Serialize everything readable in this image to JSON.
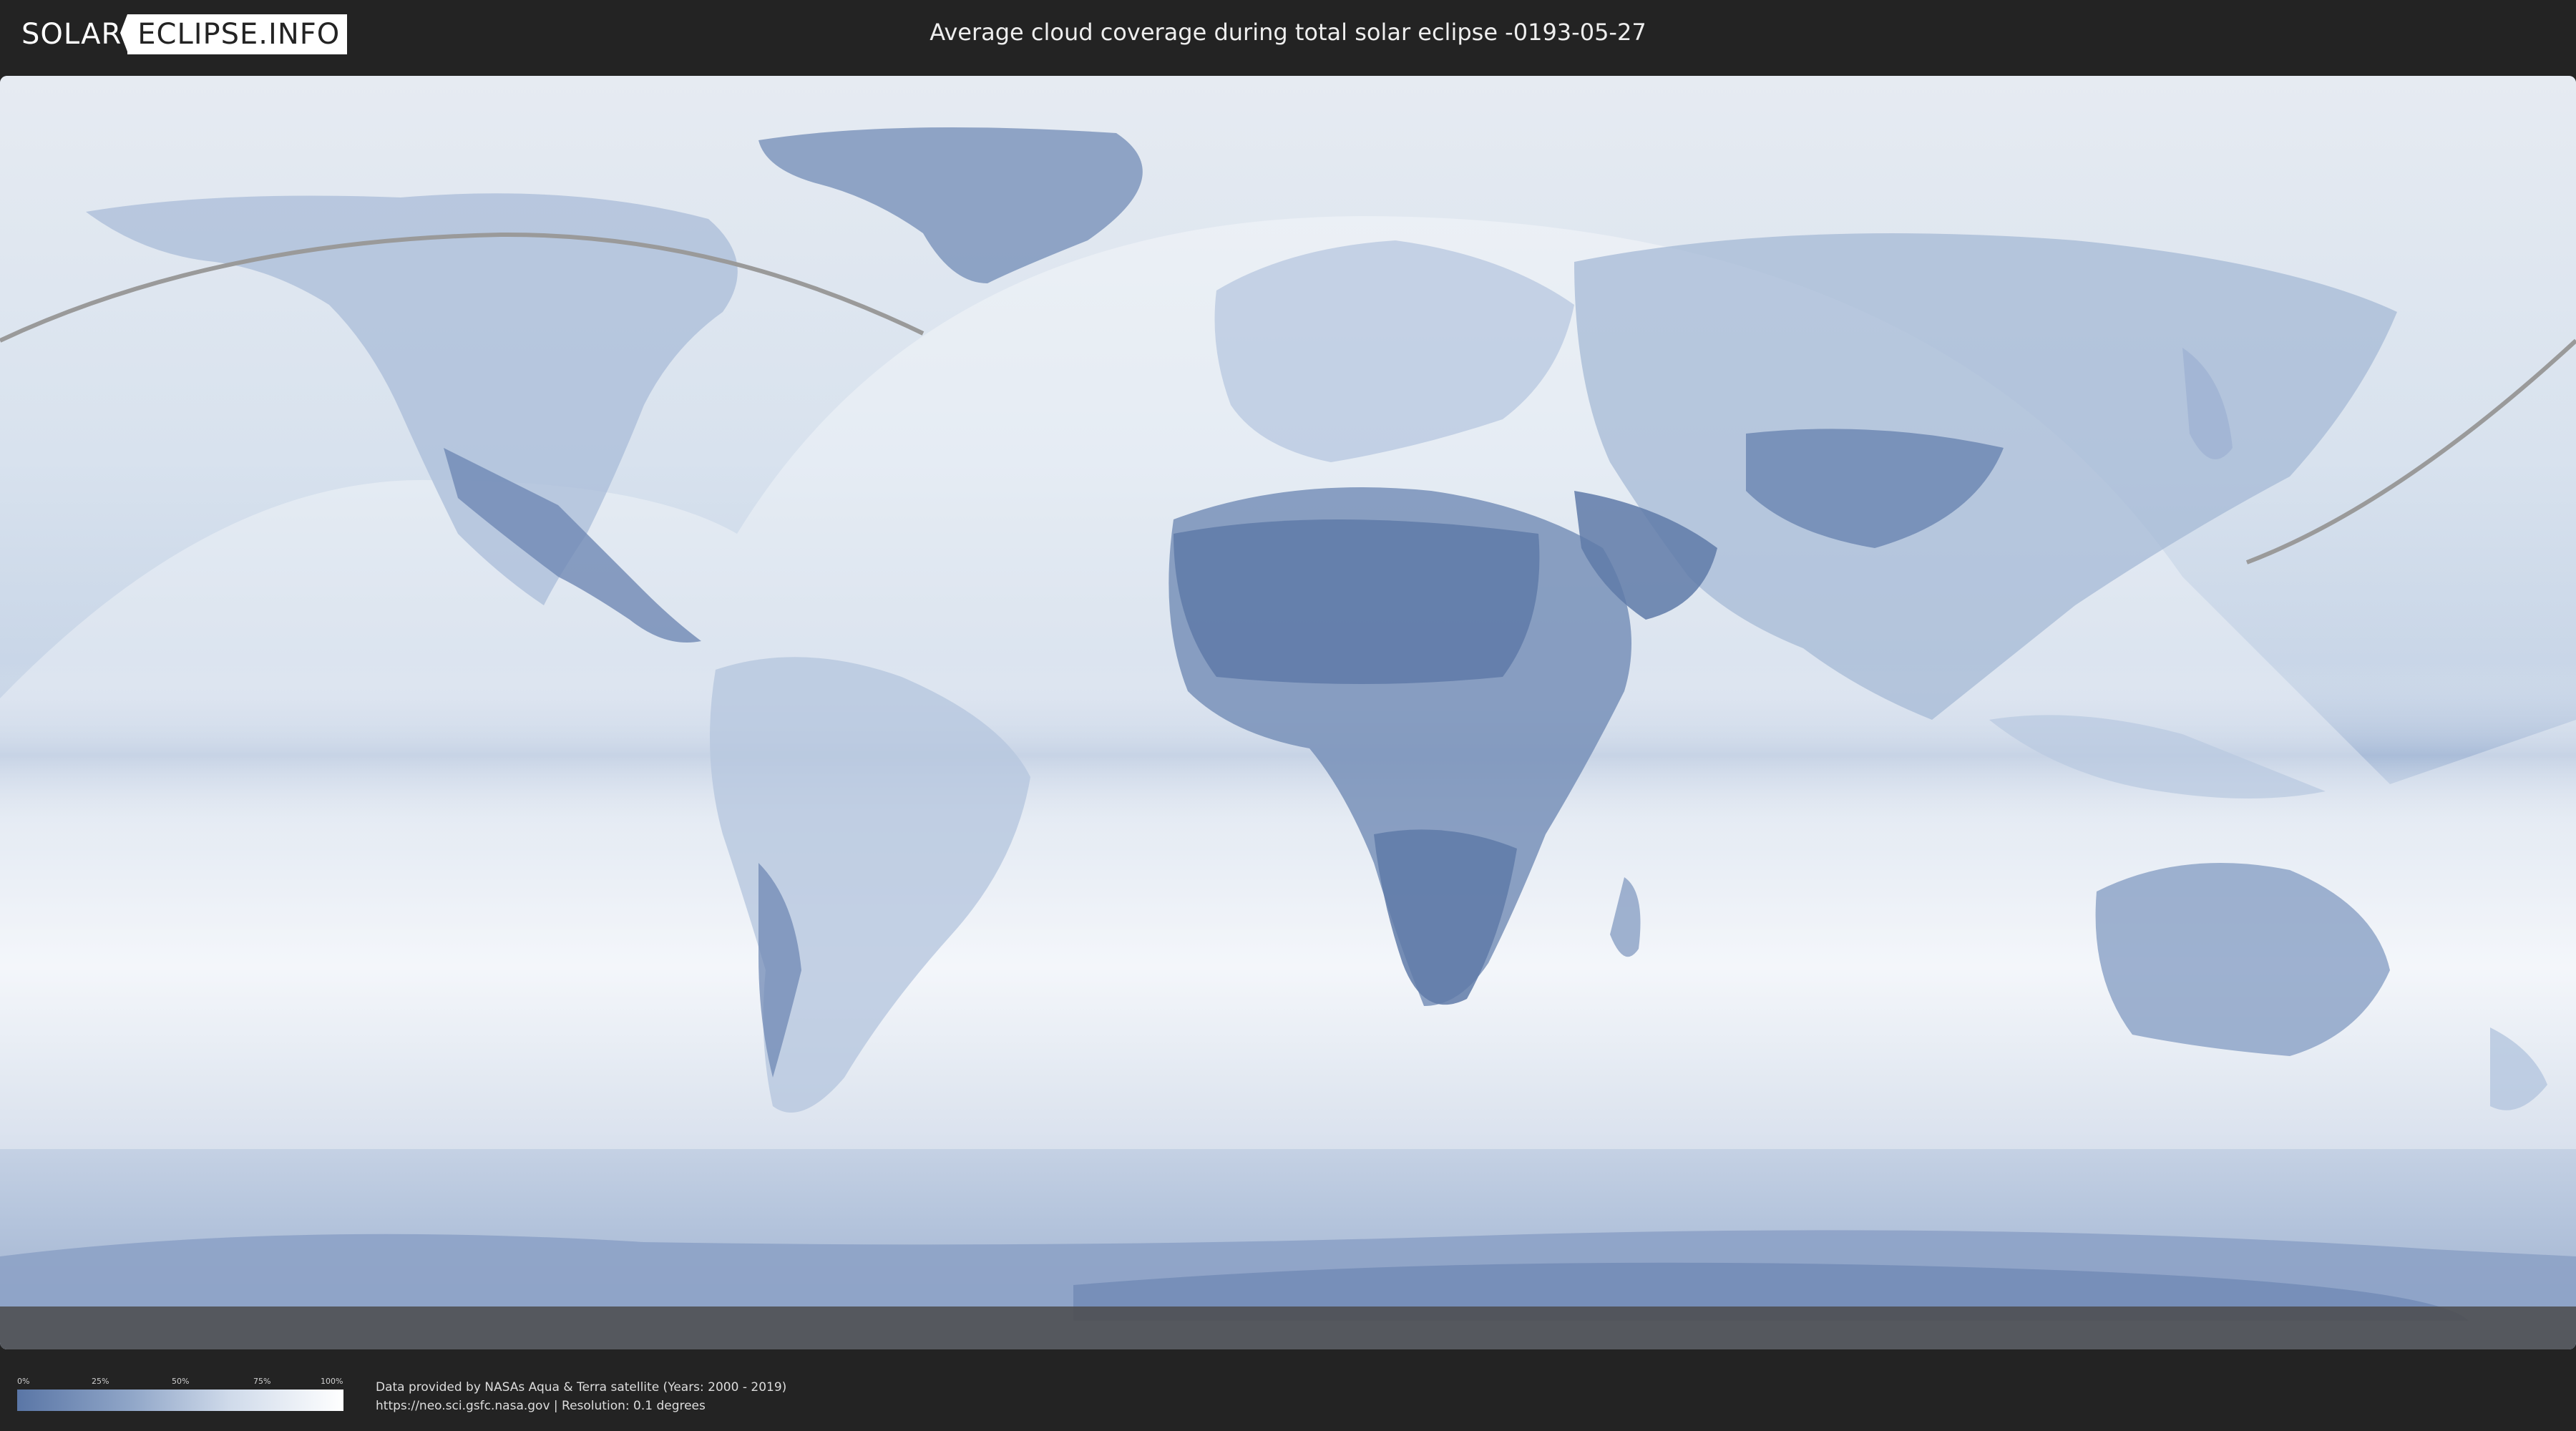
{
  "header": {
    "logo_left": "SOLAR",
    "logo_right": "ECLIPSE.INFO",
    "title": "Average cloud coverage during total solar eclipse -0193-05-27"
  },
  "legend": {
    "ticks": [
      "0%",
      "25%",
      "50%",
      "75%",
      "100%"
    ],
    "scale_colors": [
      "#5a76a6",
      "#90a6c8",
      "#cfdaea",
      "#ffffff"
    ]
  },
  "footer": {
    "credit_line": "Data provided by NASAs Aqua & Terra satellite (Years: 2000 - 2019)",
    "source_line": "https://neo.sci.gsfc.nasa.gov | Resolution: 0.1 degrees"
  },
  "map": {
    "ocean_color": "#dfe7f1",
    "land_cloud_low_color": "#6f88b4",
    "highlight_color": "#ffffff",
    "path_color": "#9a9a9a"
  }
}
